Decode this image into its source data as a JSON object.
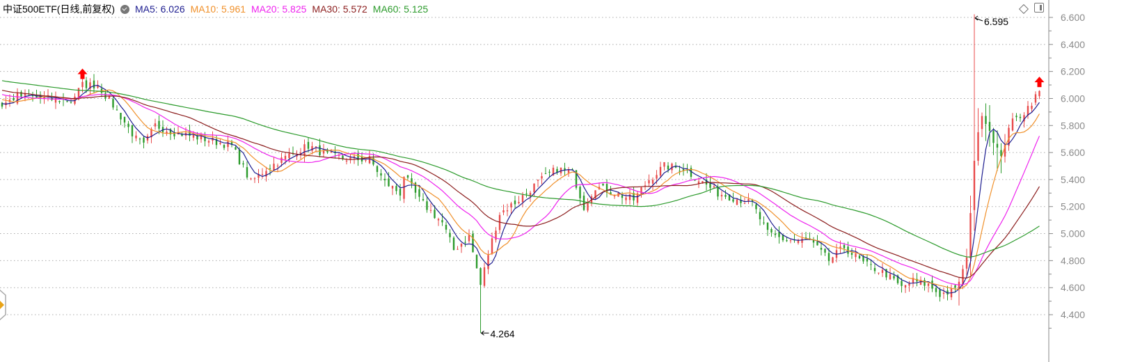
{
  "header": {
    "title": "中证500ETF(日线,前复权)",
    "ma_labels": [
      {
        "text": "MA5: 6.026",
        "color": "#1c1c8f"
      },
      {
        "text": "MA10: 5.961",
        "color": "#f0902a"
      },
      {
        "text": "MA20: 5.825",
        "color": "#ee22ee"
      },
      {
        "text": "MA30: 5.572",
        "color": "#8b1c1c"
      },
      {
        "text": "MA60: 5.125",
        "color": "#2a9a2a"
      }
    ]
  },
  "chart_data": {
    "type": "candlestick",
    "title": "中证500ETF(日线,前复权)",
    "ylim": [
      4.264,
      6.6
    ],
    "yticks": [
      "6.600",
      "6.400",
      "6.200",
      "6.000",
      "5.800",
      "5.600",
      "5.400",
      "5.200",
      "5.000",
      "4.800",
      "4.600",
      "4.400"
    ],
    "ytick_values": [
      6.6,
      6.4,
      6.2,
      6.0,
      5.8,
      5.6,
      5.4,
      5.2,
      5.0,
      4.8,
      4.6,
      4.4
    ],
    "bars": 272,
    "close_path": [
      [
        -60,
        6.25
      ],
      [
        -30,
        6.15
      ],
      [
        -10,
        6.05
      ],
      [
        0,
        5.95
      ],
      [
        4,
        6.02
      ],
      [
        11,
        6.0
      ],
      [
        18,
        5.98
      ],
      [
        21,
        6.1
      ],
      [
        25,
        6.1
      ],
      [
        29,
        5.95
      ],
      [
        35,
        5.7
      ],
      [
        37,
        5.65
      ],
      [
        40,
        5.8
      ],
      [
        45,
        5.75
      ],
      [
        53,
        5.7
      ],
      [
        60,
        5.65
      ],
      [
        65,
        5.38
      ],
      [
        69,
        5.48
      ],
      [
        75,
        5.58
      ],
      [
        80,
        5.65
      ],
      [
        85,
        5.58
      ],
      [
        91,
        5.55
      ],
      [
        96,
        5.55
      ],
      [
        100,
        5.38
      ],
      [
        104,
        5.3
      ],
      [
        105,
        5.43
      ],
      [
        109,
        5.25
      ],
      [
        115,
        5.08
      ],
      [
        118,
        4.88
      ],
      [
        122,
        4.98
      ],
      [
        125,
        4.62
      ],
      [
        127,
        4.85
      ],
      [
        130,
        5.15
      ],
      [
        135,
        5.25
      ],
      [
        140,
        5.38
      ],
      [
        145,
        5.48
      ],
      [
        149,
        5.45
      ],
      [
        152,
        5.2
      ],
      [
        155,
        5.35
      ],
      [
        160,
        5.3
      ],
      [
        165,
        5.25
      ],
      [
        169,
        5.4
      ],
      [
        173,
        5.5
      ],
      [
        178,
        5.48
      ],
      [
        182,
        5.4
      ],
      [
        187,
        5.3
      ],
      [
        193,
        5.25
      ],
      [
        196,
        5.22
      ],
      [
        200,
        5.0
      ],
      [
        205,
        4.95
      ],
      [
        211,
        4.95
      ],
      [
        216,
        4.8
      ],
      [
        220,
        4.9
      ],
      [
        225,
        4.78
      ],
      [
        231,
        4.7
      ],
      [
        235,
        4.6
      ],
      [
        238,
        4.65
      ],
      [
        242,
        4.62
      ],
      [
        245,
        4.55
      ],
      [
        249,
        4.58
      ],
      [
        252,
        4.8
      ],
      [
        254,
        5.55
      ],
      [
        256,
        5.9
      ],
      [
        259,
        5.7
      ],
      [
        261,
        5.55
      ],
      [
        263,
        5.8
      ],
      [
        267,
        5.9
      ],
      [
        271,
        6.05
      ]
    ],
    "ma_periods": [
      5,
      10,
      20,
      30,
      60
    ],
    "annotations": [
      {
        "label": "6.595",
        "bar": 254,
        "value": 6.595,
        "kind": "high"
      },
      {
        "label": "4.264",
        "bar": 125,
        "value": 4.264,
        "kind": "low"
      }
    ],
    "signal_arrows": [
      {
        "bar": 21,
        "value": 6.18
      },
      {
        "bar": 271,
        "value": 6.12
      }
    ],
    "colors": {
      "up": "#e8494a",
      "down": "#2a9a2a",
      "grid": "#aaaaaa",
      "axis": "#888888",
      "signal": "#ff0000"
    }
  }
}
